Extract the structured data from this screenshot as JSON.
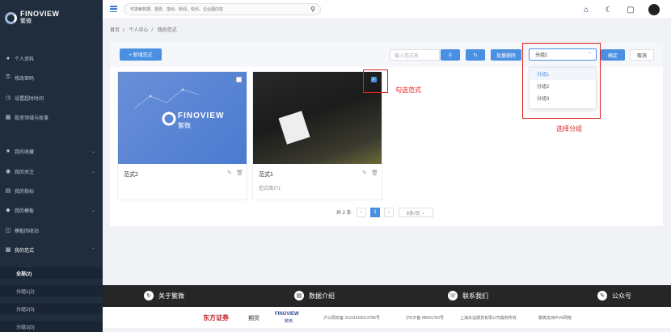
{
  "brand": {
    "en": "FINOVIEW",
    "cn": "繁微"
  },
  "sidebar": {
    "items": [
      {
        "label": "个人资料",
        "icon": "user-icon"
      },
      {
        "label": "修改密码",
        "icon": "key-icon"
      },
      {
        "label": "设置超时时间",
        "icon": "clock-icon"
      },
      {
        "label": "投资领域与故事",
        "icon": "book-icon"
      },
      {
        "label": "我的收藏",
        "icon": "star-icon"
      },
      {
        "label": "我的关注",
        "icon": "eye-icon"
      },
      {
        "label": "我的指标",
        "icon": "chart-icon"
      },
      {
        "label": "我的模板",
        "icon": "layers-icon"
      },
      {
        "label": "模板回收站",
        "icon": "trash-icon"
      },
      {
        "label": "我的范式",
        "icon": "folder-icon"
      }
    ],
    "subitems": [
      "全部(2)",
      "分组1(2)",
      "分组2(0)",
      "分组3(0)"
    ]
  },
  "topbar": {
    "search_placeholder": "可搜索数据、报告、指标、新闻、快讯、企业图内容"
  },
  "breadcrumb": [
    "首页",
    "个人中心",
    "我的范式"
  ],
  "toolbar": {
    "new_label": "+ 新增范式",
    "name_placeholder": "输入范式名",
    "batch_delete": "批量删除",
    "group_value": "分组1",
    "confirm": "确定",
    "cancel": "取消"
  },
  "group_options": [
    "分组1",
    "分组2",
    "分组3"
  ],
  "cards": [
    {
      "title": "范式2",
      "sub": "",
      "checked": false
    },
    {
      "title": "范式1",
      "sub": "范式简介1",
      "checked": true
    }
  ],
  "pagination": {
    "total": "共 2 条",
    "page": "1",
    "size": "8条/页"
  },
  "annotations": {
    "check_label": "勾选范式",
    "group_label": "选择分组"
  },
  "footer": {
    "items": [
      "关于繁微",
      "数据介绍",
      "联系我们",
      "公众号"
    ],
    "copyright_brand1": "东方证券",
    "copyright_brand2": "期货",
    "beian1": "沪公网安备 31011502013786号",
    "beian2": "沪ICP备 08001760号",
    "company": "上海东证期货有限公司版权所有",
    "ipv6": "繁微支持IPV6网络"
  },
  "colors": {
    "primary": "#4a90e2",
    "sidebar": "#1f2d3d",
    "annotation": "#e02020"
  }
}
